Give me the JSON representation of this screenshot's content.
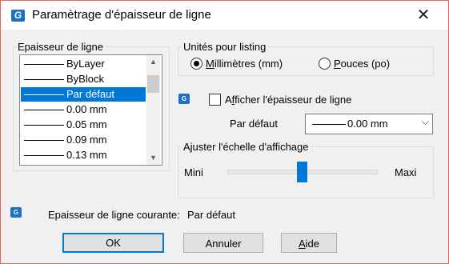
{
  "window": {
    "title": "Paramètrage d'épaisseur de ligne",
    "close_glyph": "✕",
    "app_icon": "app-logo-icon"
  },
  "lineweight_group": {
    "label": "Epaisseur de ligne",
    "items": [
      {
        "label": "ByLayer",
        "selected": false
      },
      {
        "label": "ByBlock",
        "selected": false
      },
      {
        "label": "Par défaut",
        "selected": true
      },
      {
        "label": "0.00 mm",
        "selected": false
      },
      {
        "label": "0.05 mm",
        "selected": false
      },
      {
        "label": "0.09 mm",
        "selected": false
      },
      {
        "label": "0.13 mm",
        "selected": false
      }
    ]
  },
  "units_group": {
    "label": "Unités pour listing",
    "mm_label": "Millimètres (mm)",
    "in_label": "Pouces (po)",
    "selected": "mm"
  },
  "display": {
    "checkbox_label": "Afficher l'épaisseur de ligne",
    "checked": false
  },
  "default": {
    "label": "Par défaut",
    "value": "0.00 mm"
  },
  "scale_group": {
    "label": "Ajuster l'échelle d'affichage",
    "min_label": "Mini",
    "max_label": "Maxi",
    "level": 0.5
  },
  "current": {
    "label": "Epaisseur de ligne courante:",
    "value": "Par défaut"
  },
  "buttons": {
    "ok": "OK",
    "cancel": "Annuler",
    "help": "Aide"
  },
  "colors": {
    "accent": "#0078d7",
    "icon_blue": "#1f6fc5"
  }
}
